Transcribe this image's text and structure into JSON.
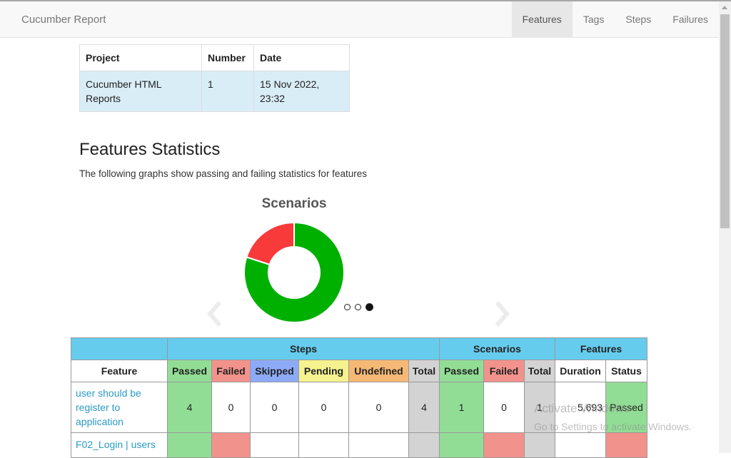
{
  "navbar": {
    "brand": "Cucumber Report",
    "items": [
      {
        "label": "Features",
        "active": true
      },
      {
        "label": "Tags"
      },
      {
        "label": "Steps"
      },
      {
        "label": "Failures"
      }
    ]
  },
  "meta": {
    "headers": [
      "Project",
      "Number",
      "Date"
    ],
    "project_line1": "Cucumber HTML",
    "project_line2": "Reports",
    "number": "1",
    "date_line1": "15 Nov 2022,",
    "date_line2": "23:32"
  },
  "stats": {
    "title": "Features Statistics",
    "description": "The following graphs show passing and failing statistics for features"
  },
  "carousel": {
    "dots": 3,
    "active_index": 2
  },
  "chart_data": {
    "type": "pie",
    "title": "Scenarios",
    "donut": true,
    "slices": [
      {
        "value": 80,
        "color": "#00b000"
      },
      {
        "value": 20,
        "color": "#f83a3a"
      }
    ]
  },
  "summary": {
    "groups": {
      "steps": "Steps",
      "scenarios": "Scenarios",
      "features": "Features"
    },
    "headers": {
      "feature": "Feature",
      "passed": "Passed",
      "failed": "Failed",
      "skipped": "Skipped",
      "pending": "Pending",
      "undefined": "Undefined",
      "total": "Total",
      "sc_passed": "Passed",
      "sc_failed": "Failed",
      "sc_total": "Total",
      "duration": "Duration",
      "status": "Status"
    },
    "rows": [
      {
        "feature_line1": "user should be",
        "feature_line2": "register to",
        "feature_line3": "application",
        "passed": "4",
        "failed": "0",
        "skipped": "0",
        "pending": "0",
        "undefined": "0",
        "total": "4",
        "sc_passed": "1",
        "sc_failed": "0",
        "sc_total": "1",
        "duration": "5.693",
        "status": "Passed"
      },
      {
        "feature_line1": "F02_Login | users"
      }
    ]
  },
  "watermark": {
    "line1": "Activate Windows",
    "line2": "Go to Settings to activate Windows."
  }
}
